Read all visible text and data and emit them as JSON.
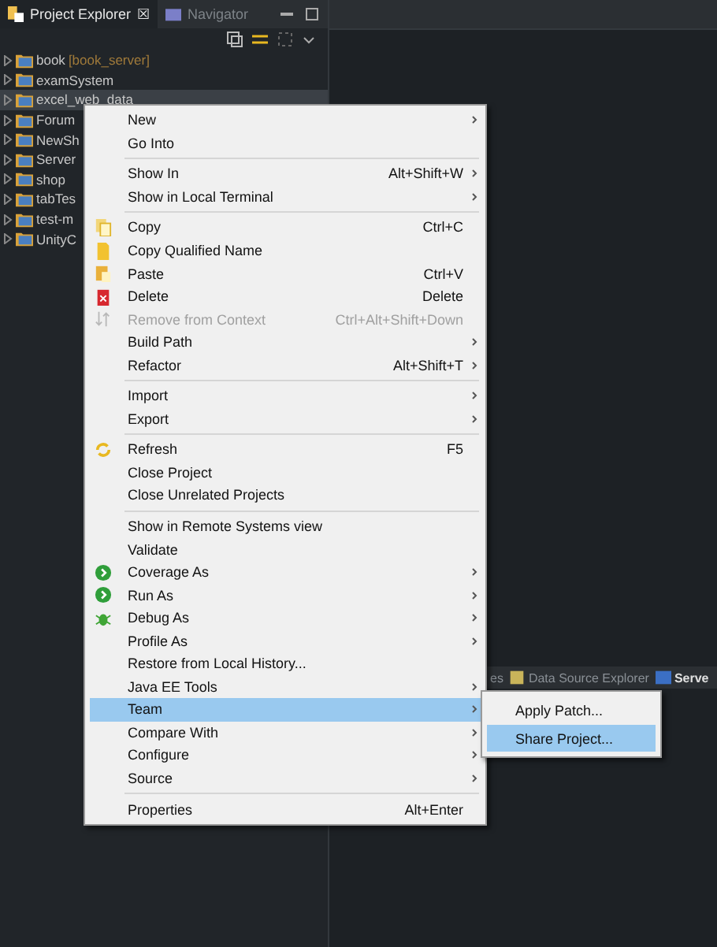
{
  "explorer": {
    "tabs": [
      {
        "label": "Project Explorer",
        "close": "☒",
        "selected": true
      },
      {
        "label": "Navigator",
        "selected": false
      }
    ],
    "projects": [
      {
        "name": "book",
        "decoration": "[book_server]",
        "selected": false
      },
      {
        "name": "examSystem",
        "selected": false
      },
      {
        "name": "excel_web_data",
        "selected": true
      },
      {
        "name": "Forum",
        "selected": false
      },
      {
        "name": "NewSh",
        "selected": false
      },
      {
        "name": "Server",
        "selected": false
      },
      {
        "name": "shop",
        "selected": false
      },
      {
        "name": "tabTes",
        "selected": false
      },
      {
        "name": "test-m",
        "selected": false
      },
      {
        "name": "UnityC",
        "selected": false
      }
    ]
  },
  "bottom_tabs": [
    {
      "label": "es"
    },
    {
      "label": "Data Source Explorer"
    },
    {
      "label": "Serve"
    }
  ],
  "context_menu": [
    {
      "kind": "item",
      "label": "New",
      "submenu": true,
      "disabled": false,
      "selected": false
    },
    {
      "kind": "item",
      "label": "Go Into",
      "submenu": false,
      "disabled": false,
      "selected": false
    },
    {
      "kind": "separator"
    },
    {
      "kind": "item",
      "label": "Show In",
      "shortcut": "Alt+Shift+W",
      "submenu": true,
      "disabled": false,
      "selected": false
    },
    {
      "kind": "item",
      "label": "Show in Local Terminal",
      "submenu": true,
      "disabled": false,
      "selected": false
    },
    {
      "kind": "separator"
    },
    {
      "kind": "item",
      "label": "Copy",
      "shortcut": "Ctrl+C",
      "submenu": false,
      "disabled": false,
      "selected": false
    },
    {
      "kind": "item",
      "label": "Copy Qualified Name",
      "submenu": false,
      "disabled": false,
      "selected": false
    },
    {
      "kind": "item",
      "label": "Paste",
      "shortcut": "Ctrl+V",
      "submenu": false,
      "disabled": false,
      "selected": false
    },
    {
      "kind": "item",
      "label": "Delete",
      "shortcut": "Delete",
      "submenu": false,
      "disabled": false,
      "selected": false
    },
    {
      "kind": "item",
      "label": "Remove from Context",
      "shortcut": "Ctrl+Alt+Shift+Down",
      "submenu": false,
      "disabled": true,
      "selected": false
    },
    {
      "kind": "item",
      "label": "Build Path",
      "submenu": true,
      "disabled": false,
      "selected": false
    },
    {
      "kind": "item",
      "label": "Refactor",
      "shortcut": "Alt+Shift+T",
      "submenu": true,
      "disabled": false,
      "selected": false
    },
    {
      "kind": "separator"
    },
    {
      "kind": "item",
      "label": "Import",
      "submenu": true,
      "disabled": false,
      "selected": false
    },
    {
      "kind": "item",
      "label": "Export",
      "submenu": true,
      "disabled": false,
      "selected": false
    },
    {
      "kind": "separator"
    },
    {
      "kind": "item",
      "label": "Refresh",
      "shortcut": "F5",
      "submenu": false,
      "disabled": false,
      "selected": false
    },
    {
      "kind": "item",
      "label": "Close Project",
      "submenu": false,
      "disabled": false,
      "selected": false
    },
    {
      "kind": "item",
      "label": "Close Unrelated Projects",
      "submenu": false,
      "disabled": false,
      "selected": false
    },
    {
      "kind": "separator"
    },
    {
      "kind": "item",
      "label": "Show in Remote Systems view",
      "submenu": false,
      "disabled": false,
      "selected": false
    },
    {
      "kind": "item",
      "label": "Validate",
      "submenu": false,
      "disabled": false,
      "selected": false
    },
    {
      "kind": "item",
      "label": "Coverage As",
      "submenu": true,
      "disabled": false,
      "selected": false
    },
    {
      "kind": "item",
      "label": "Run As",
      "submenu": true,
      "disabled": false,
      "selected": false
    },
    {
      "kind": "item",
      "label": "Debug As",
      "submenu": true,
      "disabled": false,
      "selected": false
    },
    {
      "kind": "item",
      "label": "Profile As",
      "submenu": true,
      "disabled": false,
      "selected": false
    },
    {
      "kind": "item",
      "label": "Restore from Local History...",
      "submenu": false,
      "disabled": false,
      "selected": false
    },
    {
      "kind": "item",
      "label": "Java EE Tools",
      "submenu": true,
      "disabled": false,
      "selected": false
    },
    {
      "kind": "item",
      "label": "Team",
      "submenu": true,
      "disabled": false,
      "selected": true
    },
    {
      "kind": "item",
      "label": "Compare With",
      "submenu": true,
      "disabled": false,
      "selected": false
    },
    {
      "kind": "item",
      "label": "Configure",
      "submenu": true,
      "disabled": false,
      "selected": false
    },
    {
      "kind": "item",
      "label": "Source",
      "submenu": true,
      "disabled": false,
      "selected": false
    },
    {
      "kind": "separator"
    },
    {
      "kind": "item",
      "label": "Properties",
      "shortcut": "Alt+Enter",
      "submenu": false,
      "disabled": false,
      "selected": false
    }
  ],
  "team_submenu": [
    {
      "label": "Apply Patch...",
      "selected": false
    },
    {
      "label": "Share Project...",
      "selected": true
    }
  ]
}
